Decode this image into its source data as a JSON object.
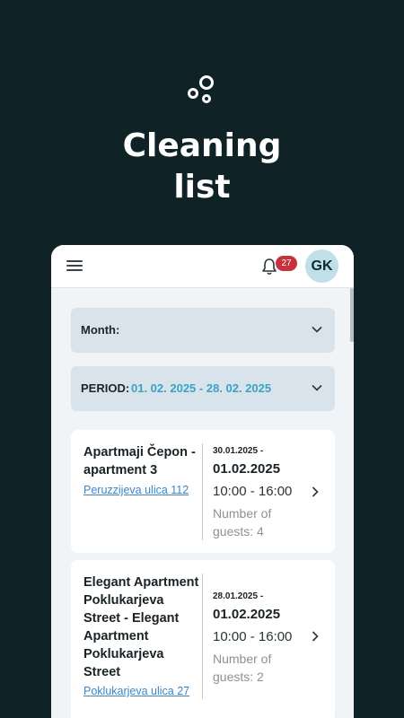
{
  "hero": {
    "title": "Cleaning\nlist",
    "logo_icon": "bubbles-logo"
  },
  "topbar": {
    "menu_icon": "hamburger-menu-icon",
    "bell_icon": "bell-icon",
    "notification_count": "27",
    "avatar_initials": "GK"
  },
  "filters": {
    "month_label": "Month:",
    "month_value": "",
    "period_label": "PERIOD:",
    "period_value": "01. 02. 2025 - 28. 02. 2025"
  },
  "cards": [
    {
      "title": "Apartmaji Čepon - apartment 3",
      "address": "Peruzzijeva ulica 112",
      "date_from": "30.01.2025 -",
      "date_to": "01.02.2025",
      "time": "10:00 - 16:00",
      "guests": "Number of guests: 4"
    },
    {
      "title": "Elegant Apartment Poklukarjeva Street - Elegant Apartment Poklukarjeva Street",
      "address": "Poklukarjeva ulica 27",
      "date_from": "28.01.2025 -",
      "date_to": "01.02.2025",
      "time": "10:00 - 16:00",
      "guests": "Number of guests: 2"
    }
  ],
  "colors": {
    "background": "#0f2326",
    "accent": "#3aa3c2",
    "badge": "#c8303c",
    "link": "#3a86c8"
  }
}
